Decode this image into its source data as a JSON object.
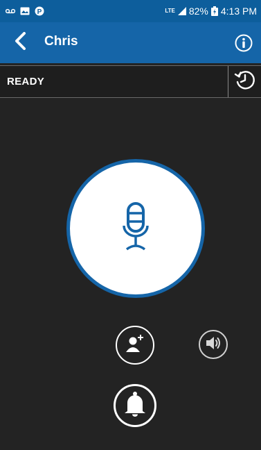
{
  "status_bar": {
    "network": "LTE",
    "battery": "82%",
    "time": "4:13 PM"
  },
  "header": {
    "contact_name": "Chris",
    "back_icon": "chevron-left-icon",
    "info_icon": "info-icon"
  },
  "ready_bar": {
    "status": "READY",
    "history_icon": "history-icon"
  },
  "controls": {
    "ptt_icon": "microphone-icon",
    "add_contact_icon": "add-user-icon",
    "speaker_icon": "speaker-icon",
    "alert_icon": "bell-icon"
  },
  "colors": {
    "primary_blue": "#1565a8",
    "status_bar_blue": "#0d5e9c",
    "background": "#232323"
  }
}
